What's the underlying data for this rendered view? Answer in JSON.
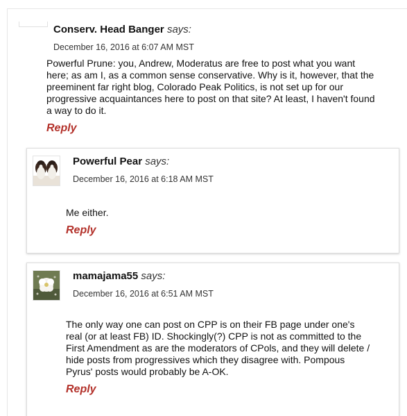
{
  "comments": [
    {
      "author": "Conserv. Head Banger",
      "says": "says:",
      "timestamp": "December 16, 2016 at 6:07 AM MST",
      "body_lines": [
        "Powerful Prune: you, Andrew, Moderatus are free to post what you want",
        "here; as am I, as a common sense conservative. Why is it, however, that the",
        "preeminent far right blog, Colorado Peak Politics, is not set up for our",
        "progressive acquaintances here to post on that site? At least, I haven't found",
        "a way to do it."
      ],
      "reply_label": "Reply"
    },
    {
      "author": "Powerful Pear",
      "says": "says:",
      "timestamp": "December 16, 2016 at 6:18 AM MST",
      "body_lines": [
        "Me either."
      ],
      "reply_label": "Reply",
      "avatar_icon": "dog-photo-icon"
    },
    {
      "author": "mamajama55",
      "says": "says:",
      "timestamp": "December 16, 2016 at 6:51 AM MST",
      "body_lines": [
        "The only way one can post on CPP is on their FB page under one's",
        "real (or at least FB) ID.  Shockingly(?) CPP is not as committed to the",
        "First Amendment as are the moderators of CPols, and they will delete /",
        "hide posts from progressives which they disagree with. Pompous",
        "Pyrus' posts would probably be A-OK."
      ],
      "reply_label": "Reply",
      "avatar_icon": "flower-photo-icon"
    }
  ],
  "colors": {
    "reply": "#b3312a",
    "border": "#dddddd"
  }
}
